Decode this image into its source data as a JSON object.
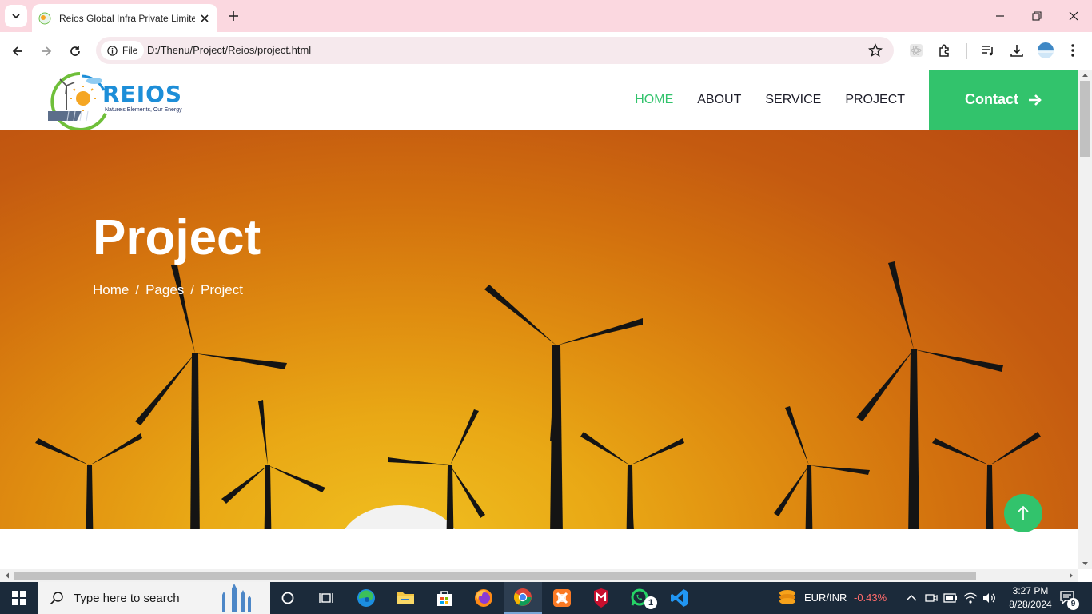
{
  "browser": {
    "tab_title": "Reios Global Infra Private Limite",
    "address_scheme_label": "File",
    "url": "D:/Thenu/Project/Reios/project.html"
  },
  "site": {
    "logo": {
      "name": "REIOS",
      "tagline": "Nature's Elements, Our Energy"
    },
    "nav": [
      {
        "label": "HOME",
        "active": true
      },
      {
        "label": "ABOUT",
        "active": false
      },
      {
        "label": "SERVICE",
        "active": false
      },
      {
        "label": "PROJECT",
        "active": false
      }
    ],
    "contact_label": "Contact",
    "accent_color": "#32c36c",
    "hero": {
      "title": "Project",
      "breadcrumb": [
        "Home",
        "Pages",
        "Project"
      ],
      "breadcrumb_separator": "/"
    }
  },
  "taskbar": {
    "search_placeholder": "Type here to search",
    "ticker_symbol": "EUR/INR",
    "ticker_change": "-0.43%",
    "ticker_color": "#ff6b6b",
    "whatsapp_badge": "1",
    "notification_count": "9",
    "time": "3:27 PM",
    "date": "8/28/2024"
  }
}
